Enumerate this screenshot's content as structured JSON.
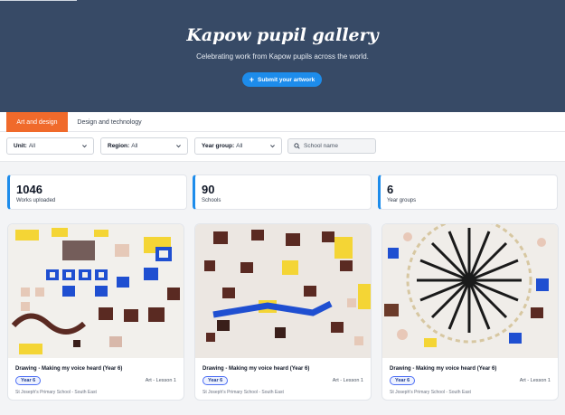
{
  "hero": {
    "title": "Kapow pupil gallery",
    "subtitle": "Celebrating work from Kapow pupils across the world.",
    "submit_label": "Submit your artwork",
    "background_color": "#374a66",
    "button_color": "#1d8ceb"
  },
  "tabs": [
    {
      "label": "Art and design",
      "active": true
    },
    {
      "label": "Design and technology",
      "active": false
    }
  ],
  "filters": {
    "unit": {
      "label": "Unit:",
      "value": "All"
    },
    "region": {
      "label": "Region:",
      "value": "All"
    },
    "year_group": {
      "label": "Year group:",
      "value": "All"
    },
    "search": {
      "placeholder": "School name",
      "value": "",
      "icon": "search-icon"
    }
  },
  "stats": [
    {
      "value": "1046",
      "label": "Works uploaded"
    },
    {
      "value": "90",
      "label": "Schools"
    },
    {
      "value": "6",
      "label": "Year groups"
    }
  ],
  "accent_color": "#f06a2b",
  "cards": [
    {
      "title": "Drawing - Making my voice heard (Year 6)",
      "badge": "Year 6",
      "lesson": "Art - Lesson 1",
      "school": "St Joseph's Primary School - South East"
    },
    {
      "title": "Drawing - Making my voice heard (Year 6)",
      "badge": "Year 6",
      "lesson": "Art - Lesson 1",
      "school": "St Joseph's Primary School - South East"
    },
    {
      "title": "Drawing - Making my voice heard (Year 6)",
      "badge": "Year 6",
      "lesson": "Art - Lesson 1",
      "school": "St Joseph's Primary School - South East"
    }
  ]
}
